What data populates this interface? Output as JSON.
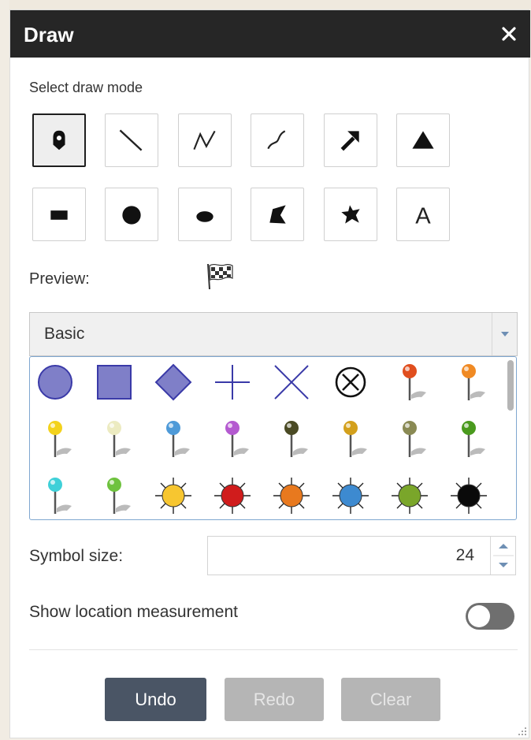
{
  "panel": {
    "title": "Draw",
    "close_icon": "close-icon"
  },
  "draw_mode": {
    "label": "Select draw mode",
    "modes": [
      {
        "name": "point",
        "icon": "point-pin-icon",
        "active": true
      },
      {
        "name": "line",
        "icon": "line-icon"
      },
      {
        "name": "polyline",
        "icon": "polyline-icon"
      },
      {
        "name": "freehand-polyline",
        "icon": "freehand-line-icon"
      },
      {
        "name": "arrow",
        "icon": "arrow-icon"
      },
      {
        "name": "triangle",
        "icon": "triangle-icon"
      },
      {
        "name": "rectangle",
        "icon": "rectangle-icon"
      },
      {
        "name": "circle",
        "icon": "circle-icon"
      },
      {
        "name": "ellipse",
        "icon": "ellipse-icon"
      },
      {
        "name": "polygon",
        "icon": "polygon-icon"
      },
      {
        "name": "freehand-polygon",
        "icon": "freehand-polygon-icon"
      },
      {
        "name": "text",
        "icon": "text-icon",
        "glyph": "A"
      }
    ]
  },
  "preview": {
    "label": "Preview:",
    "icon": "checkered-flag-icon"
  },
  "symbol_set": {
    "selected": "Basic",
    "icon": "dropdown-arrow-icon"
  },
  "symbols": [
    {
      "name": "circle-symbol"
    },
    {
      "name": "square-symbol"
    },
    {
      "name": "diamond-symbol"
    },
    {
      "name": "cross-symbol"
    },
    {
      "name": "x-symbol"
    },
    {
      "name": "circle-x-symbol"
    },
    {
      "name": "pushpin-red"
    },
    {
      "name": "pushpin-orange"
    },
    {
      "name": "pushpin-yellow"
    },
    {
      "name": "pushpin-cream"
    },
    {
      "name": "pushpin-blue"
    },
    {
      "name": "pushpin-purple"
    },
    {
      "name": "pushpin-olive-dark"
    },
    {
      "name": "pushpin-gold"
    },
    {
      "name": "pushpin-olive"
    },
    {
      "name": "pushpin-green"
    },
    {
      "name": "pushpin-cyan"
    },
    {
      "name": "pushpin-lightgreen"
    },
    {
      "name": "sun-yellow"
    },
    {
      "name": "sun-red"
    },
    {
      "name": "sun-orange"
    },
    {
      "name": "sun-blue"
    },
    {
      "name": "sun-green"
    },
    {
      "name": "sun-black"
    }
  ],
  "symbol_size": {
    "label": "Symbol size:",
    "value": "24"
  },
  "location_measurement": {
    "label": "Show location measurement",
    "enabled": false
  },
  "actions": {
    "undo": "Undo",
    "redo": "Redo",
    "clear": "Clear"
  },
  "colors": {
    "header": "#262626",
    "undo_button": "#4a5565",
    "disabled_button": "#b5b5b5",
    "symbol_fill": "#7f7fc8",
    "symbol_stroke": "#3a3aa8",
    "toggle_off": "#6f6f6f"
  }
}
